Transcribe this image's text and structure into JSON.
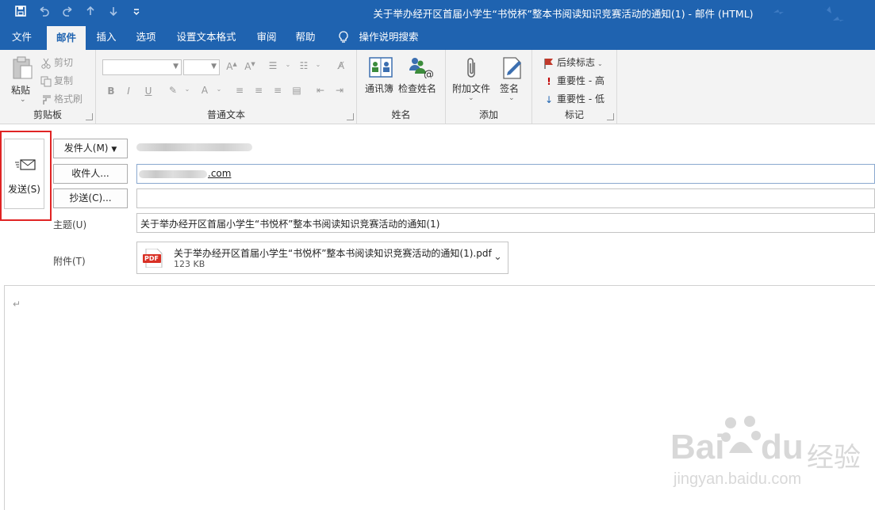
{
  "window": {
    "title": "关于举办经开区首届小学生“书悦杯”整本书阅读知识竞赛活动的通知(1)  -  邮件 (HTML)"
  },
  "quick_access": {
    "save_icon": "save-icon",
    "undo_icon": "undo-icon",
    "redo_icon": "redo-icon",
    "up_icon": "arrow-up-icon",
    "down_icon": "arrow-down-icon",
    "customize_icon": "customize-icon"
  },
  "tabs": [
    {
      "label": "文件"
    },
    {
      "label": "邮件"
    },
    {
      "label": "插入"
    },
    {
      "label": "选项"
    },
    {
      "label": "设置文本格式"
    },
    {
      "label": "审阅"
    },
    {
      "label": "帮助"
    },
    {
      "label": "操作说明搜索"
    }
  ],
  "ribbon": {
    "clipboard": {
      "paste": "粘贴",
      "cut": "剪切",
      "copy": "复制",
      "format_painter": "格式刷",
      "group_label": "剪贴板"
    },
    "basic_text": {
      "group_label": "普通文本",
      "bold": "B",
      "italic": "I",
      "underline": "U"
    },
    "names": {
      "address_book": "通讯簿",
      "check_names": "检查姓名",
      "group_label": "姓名"
    },
    "include": {
      "attach_file": "附加文件",
      "signature": "签名",
      "group_label": "添加"
    },
    "tags": {
      "follow_up": "后续标志",
      "high_importance": "重要性 - 高",
      "low_importance": "重要性 - 低",
      "group_label": "标记"
    }
  },
  "compose": {
    "send_label": "发送(S)",
    "from_button": "发件人(M)",
    "to_button": "收件人...",
    "to_value_suffix": ".com",
    "cc_button": "抄送(C)...",
    "subject_label": "主题(U)",
    "subject_value": "关于举办经开区首届小学生“书悦杯”整本书阅读知识竞赛活动的通知(1)",
    "attach_label": "附件(T)",
    "attachment": {
      "icon_text": "PDF",
      "name": "关于举办经开区首届小学生“书悦杯”整本书阅读知识竞赛活动的通知(1).pdf",
      "size": "123 KB"
    },
    "body_mark": "↵"
  },
  "watermark": {
    "text": "Bai",
    "text2": "du",
    "cn": "经验",
    "url": "jingyan.baidu.com"
  },
  "colors": {
    "titlebar": "#1f63b0",
    "highlight_border": "#e02424",
    "pdf_red": "#d93025",
    "flag_red": "#c0392b",
    "importance_high": "#c00000",
    "importance_low": "#1f63b0"
  }
}
